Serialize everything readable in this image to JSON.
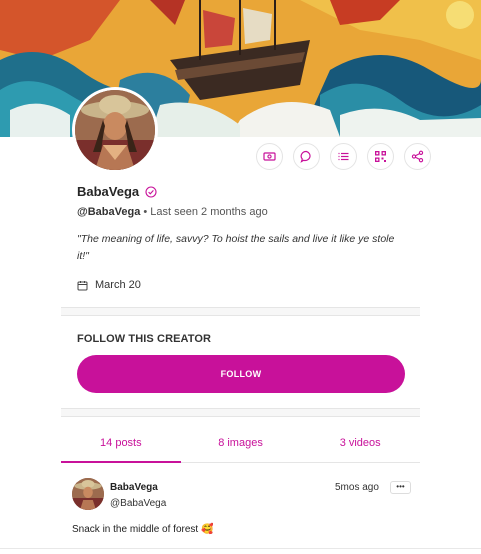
{
  "profile": {
    "display_name": "BabaVega",
    "handle": "@BabaVega",
    "last_seen": "Last seen 2 months ago",
    "bio": "\"The meaning of life, savvy? To hoist the sails and live it like ye stole it!\"",
    "joined": "March 20",
    "verified_icon": "verified-badge-icon"
  },
  "actions": [
    {
      "name": "tip-button",
      "icon": "money-icon"
    },
    {
      "name": "message-button",
      "icon": "chat-icon"
    },
    {
      "name": "lists-button",
      "icon": "list-icon"
    },
    {
      "name": "qr-button",
      "icon": "qr-code-icon"
    },
    {
      "name": "share-button",
      "icon": "share-icon"
    }
  ],
  "follow": {
    "title": "FOLLOW THIS CREATOR",
    "button_label": "FOLLOW"
  },
  "tabs": [
    {
      "label": "14 posts",
      "active": true
    },
    {
      "label": "8 images",
      "active": false
    },
    {
      "label": "3 videos",
      "active": false
    }
  ],
  "post": {
    "author": "BabaVega",
    "handle": "@BabaVega",
    "time": "5mos ago",
    "more_label": "•••",
    "text": "Snack in the middle of forest 🥰"
  },
  "colors": {
    "accent": "#c8119a",
    "separator": "#e5e5e5"
  }
}
